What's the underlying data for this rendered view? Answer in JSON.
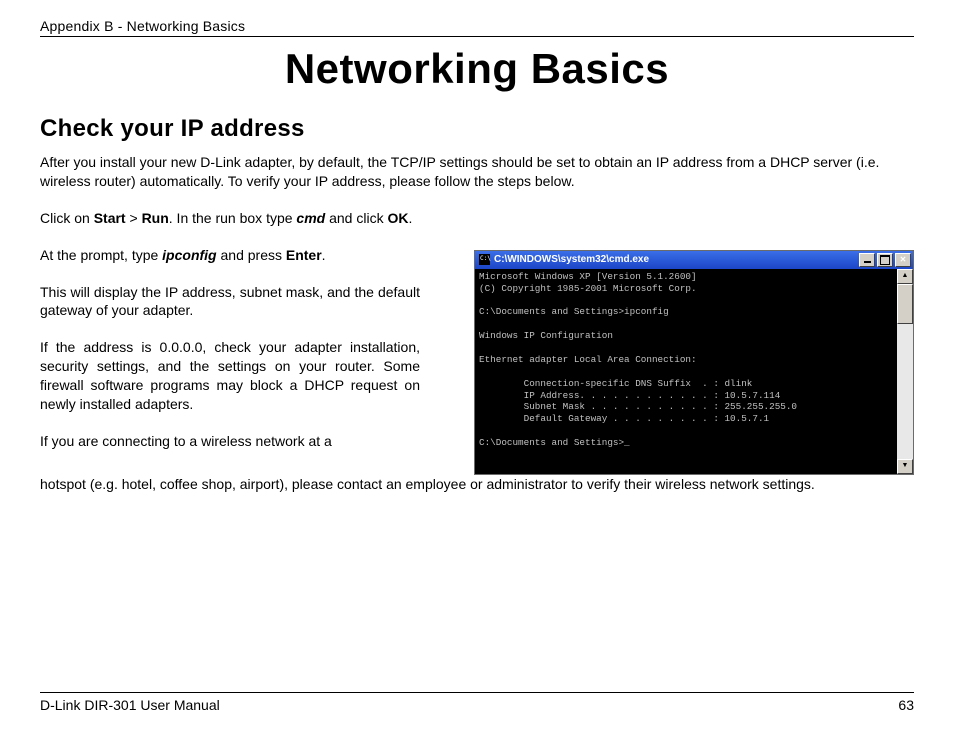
{
  "header": {
    "breadcrumb": "Appendix B - Networking Basics"
  },
  "title": "Networking Basics",
  "subtitle": "Check your IP address",
  "intro": "After you install your new D-Link adapter, by default, the TCP/IP settings should be set to obtain an IP address from a DHCP server (i.e. wireless router) automatically. To verify your IP address, please follow the steps below.",
  "step1": {
    "t1": "Click on ",
    "b1": "Start",
    "t2": " > ",
    "b2": "Run",
    "t3": ". In the run box type ",
    "bi1": "cmd",
    "t4": " and click ",
    "b3": "OK",
    "t5": "."
  },
  "left": {
    "p1": {
      "t1": "At the prompt, type ",
      "bi1": "ipconfig",
      "t2": " and press ",
      "b1": "Enter",
      "t3": "."
    },
    "p2": "This will display the IP address, subnet mask, and the default gateway of your adapter.",
    "p3": "If the address is 0.0.0.0, check your adapter installation, security settings, and the settings on your router. Some firewall software programs may block a DHCP request on newly installed adapters.",
    "p4a": "If you are connecting to a wireless network at a"
  },
  "wide_cont": "hotspot (e.g. hotel, coffee shop, airport), please contact an employee or administrator to verify their wireless network settings.",
  "cmd": {
    "title": "C:\\WINDOWS\\system32\\cmd.exe",
    "lines": "Microsoft Windows XP [Version 5.1.2600]\n(C) Copyright 1985-2001 Microsoft Corp.\n\nC:\\Documents and Settings>ipconfig\n\nWindows IP Configuration\n\nEthernet adapter Local Area Connection:\n\n        Connection-specific DNS Suffix  . : dlink\n        IP Address. . . . . . . . . . . . : 10.5.7.114\n        Subnet Mask . . . . . . . . . . . : 255.255.255.0\n        Default Gateway . . . . . . . . . : 10.5.7.1\n\nC:\\Documents and Settings>_"
  },
  "footer": {
    "left": "D-Link DIR-301 User Manual",
    "right": "63"
  }
}
